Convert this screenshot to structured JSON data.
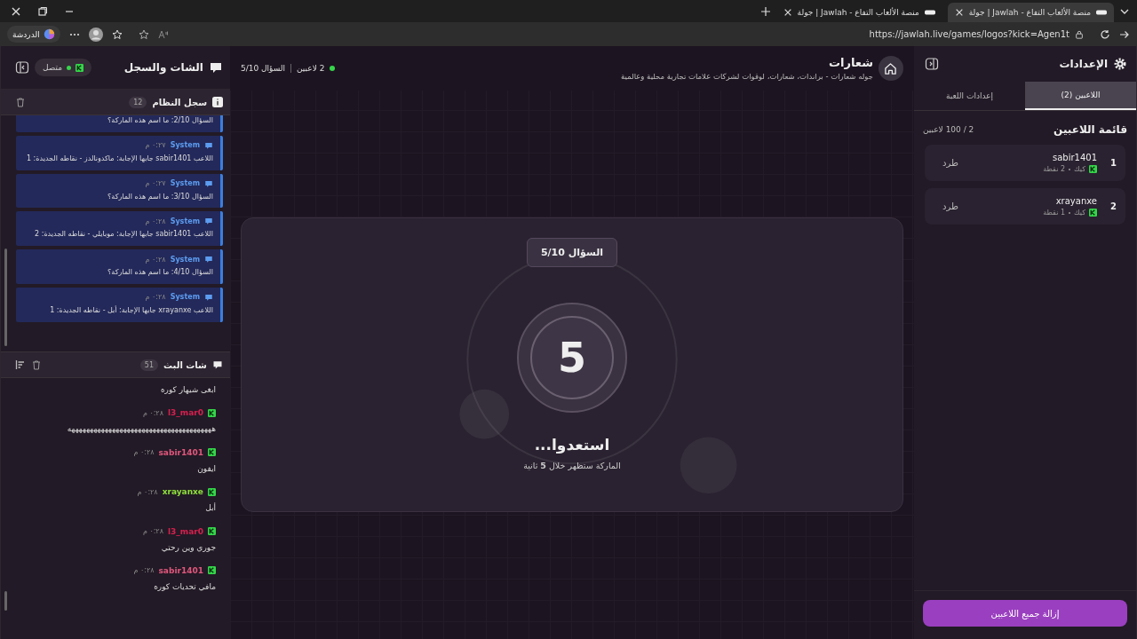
{
  "browser": {
    "tabs": [
      {
        "title": "جولة | Jawlah - منصة الألعاب التفاع",
        "selected": true
      },
      {
        "title": "جولة | Jawlah - منصة الألعاب التفاع",
        "selected": false
      }
    ],
    "copilot_label": "الدردشة",
    "url": "https://jawlah.live/games/logos?kick=Agen1t"
  },
  "settings": {
    "title": "الإعدادات",
    "tabs": [
      {
        "label": "اللاعبين (2)",
        "selected": true
      },
      {
        "label": "إعدادات اللعبة",
        "selected": false
      }
    ],
    "list_title": "قائمة اللاعبين",
    "capacity": "2 / 100 لاعبين",
    "players": [
      {
        "rank": "1",
        "name": "sabir1401",
        "platform": "كيك",
        "points": "2 نقطة",
        "action": "طرد"
      },
      {
        "rank": "2",
        "name": "xrayanxe",
        "platform": "كيك",
        "points": "1 نقطة",
        "action": "طرد"
      }
    ],
    "remove_all": "إزالة جميع اللاعبين"
  },
  "center": {
    "title": "شعارات",
    "subtitle": "جوله شعارات - براندات، شعارات، لوقوات لشركات علامات تجارية محلية وعالمية",
    "players_online": "2 لاعبين",
    "question": "السؤال 5/10",
    "card": {
      "question": "السؤال 5/10",
      "countdown": "5",
      "heading": "استعدوا...",
      "note": "الماركة ستظهر خلال **5** ثانية"
    }
  },
  "chat_panel": {
    "title": "الشات والسجل",
    "status": "متصل",
    "connected": true,
    "log": {
      "title": "سجل النظام",
      "count": "12",
      "entries": [
        {
          "text": "السؤال 2/10: ما اسم هذه الماركة؟"
        },
        {
          "sender": "System",
          "time": "٠:٢٧ م",
          "text": "اللاعب sabir1401 جابها الإجابة: ماكدونالدز - نقاطه الجديدة: 1"
        },
        {
          "sender": "System",
          "time": "٠:٢٧ م",
          "text": "السؤال 3/10: ما اسم هذه الماركة؟"
        },
        {
          "sender": "System",
          "time": "٠:٢٨ م",
          "text": "اللاعب sabir1401 جابها الإجابة: موبايلي - نقاطه الجديدة: 2"
        },
        {
          "sender": "System",
          "time": "٠:٢٨ م",
          "text": "السؤال 4/10: ما اسم هذه الماركة؟"
        },
        {
          "sender": "System",
          "time": "٠:٢٨ م",
          "text": "اللاعب xrayanxe جابها الإجابة: أبل - نقاطه الجديدة: 1"
        }
      ]
    },
    "chat": {
      "title": "شات البث",
      "count": "51",
      "messages": [
        {
          "text": "ابغى شيهار كوره"
        },
        {
          "user": "l3_mar0",
          "color": "#d6204e",
          "time": "٠:٢٨ م",
          "text": "هههههههههههههههههههههههههههههههههههههههه"
        },
        {
          "user": "sabir1401",
          "color": "#e0577c",
          "time": "٠:٢٨ م",
          "text": "ايفون"
        },
        {
          "user": "xrayanxe",
          "color": "#8fe03c",
          "time": "٠:٢٨ م",
          "text": "أبل"
        },
        {
          "user": "l3_mar0",
          "color": "#d6204e",
          "time": "٠:٢٨ م",
          "text": "جوري وين رحتي"
        },
        {
          "user": "sabir1401",
          "color": "#e0577c",
          "time": "٠:٢٨ م",
          "text": "مافي تحديات كوره"
        }
      ]
    }
  }
}
